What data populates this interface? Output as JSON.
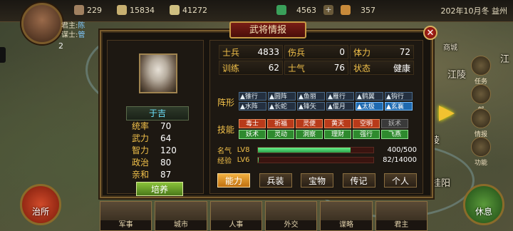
{
  "topbar": {
    "res1": "229",
    "res2": "15834",
    "res3": "41272",
    "res4": "4563",
    "res5": "357",
    "date": "202年10月冬 益州"
  },
  "lord": {
    "line1_key": "君主:",
    "line1_val": "陈",
    "line2_key": "谋士:",
    "line2_val": "管",
    "count": "2"
  },
  "map_cities": [
    "商城",
    "江",
    "江陵",
    "陵",
    "桂阳"
  ],
  "side_menu": [
    "任务",
    "邮",
    "情报",
    "功能"
  ],
  "dialog": {
    "title": "武将情报",
    "close_label": "✕"
  },
  "general": {
    "name": "于吉",
    "stats": [
      {
        "k": "统率",
        "v": "70"
      },
      {
        "k": "武力",
        "v": "64"
      },
      {
        "k": "智力",
        "v": "120"
      },
      {
        "k": "政治",
        "v": "80"
      },
      {
        "k": "亲和",
        "v": "87"
      }
    ],
    "cultivate_label": "培养"
  },
  "info_grid": [
    [
      {
        "k": "士兵",
        "v": "4833"
      },
      {
        "k": "伤兵",
        "v": "0"
      },
      {
        "k": "体力",
        "v": "72"
      }
    ],
    [
      {
        "k": "训练",
        "v": "62"
      },
      {
        "k": "士气",
        "v": "76"
      },
      {
        "k": "状态",
        "v": "健康"
      }
    ]
  ],
  "formation_label": "阵形",
  "formations": [
    [
      {
        "t": "锥行",
        "on": false
      },
      {
        "t": "圆阵",
        "on": false
      },
      {
        "t": "鱼丽",
        "on": false
      },
      {
        "t": "雁行",
        "on": false
      },
      {
        "t": "鹤翼",
        "on": false
      },
      {
        "t": "钩行",
        "on": false
      }
    ],
    [
      {
        "t": "水阵",
        "on": false
      },
      {
        "t": "长蛇",
        "on": false
      },
      {
        "t": "锋矢",
        "on": false
      },
      {
        "t": "偃月",
        "on": false
      },
      {
        "t": "太极",
        "on": true
      },
      {
        "t": "玄襄",
        "on": true
      }
    ]
  ],
  "skill_label": "技能",
  "skills": [
    [
      {
        "t": "毒士",
        "c": "red"
      },
      {
        "t": "祈福",
        "c": "red"
      },
      {
        "t": "灵便",
        "c": "red"
      },
      {
        "t": "黄天",
        "c": "red"
      },
      {
        "t": "空明",
        "c": "red"
      },
      {
        "t": "妖术",
        "c": "gray"
      }
    ],
    [
      {
        "t": "妖术",
        "c": "green"
      },
      {
        "t": "灵动",
        "c": "green"
      },
      {
        "t": "洞察",
        "c": "green"
      },
      {
        "t": "理财",
        "c": "green"
      },
      {
        "t": "强行",
        "c": "green"
      },
      {
        "t": "飞燕",
        "c": "green"
      }
    ]
  ],
  "fame": {
    "label": "名气",
    "level": "LV8",
    "value": "400/500",
    "fraction": 0.8
  },
  "exp": {
    "label": "经验",
    "level": "LV6",
    "value": "82/14000",
    "fraction": 0.006
  },
  "actions": [
    {
      "label": "能力",
      "active": true
    },
    {
      "label": "兵装",
      "active": false
    },
    {
      "label": "宝物",
      "active": false
    },
    {
      "label": "传记",
      "active": false
    },
    {
      "label": "个人",
      "active": false
    }
  ],
  "bottom_tabs": [
    "军事",
    "城市",
    "人事",
    "外交",
    "谍略",
    "君主"
  ],
  "left_button": "治所",
  "right_button": "休息",
  "colors": {
    "accent": "#f2c14a",
    "name": "#6ee4ff",
    "active_button": "#f0b040"
  }
}
